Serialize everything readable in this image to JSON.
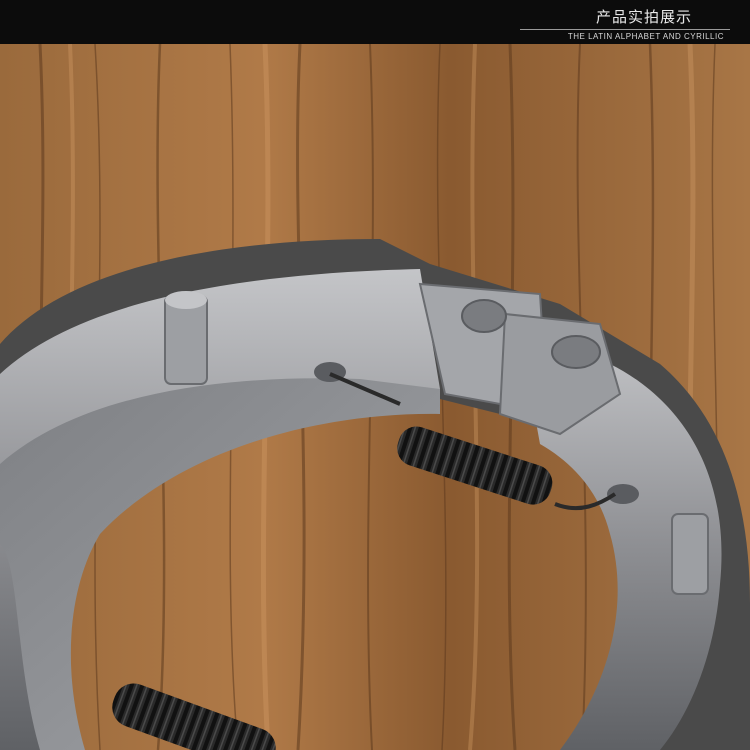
{
  "header": {
    "title": "产品实拍展示",
    "subtitle": "THE LATIN ALPHABET AND CYRILLIC"
  },
  "photo": {
    "subject": "brake-shoe-with-springs",
    "colors": {
      "wood_base": "#8a5c34",
      "wood_light": "#b07a48",
      "wood_dark": "#5e3a1e",
      "metal": "#8f9094",
      "metal_light": "#c4c5c8",
      "metal_dark": "#55575b",
      "lining": "#4a4a4a",
      "spring": "#1c1c1c"
    }
  }
}
